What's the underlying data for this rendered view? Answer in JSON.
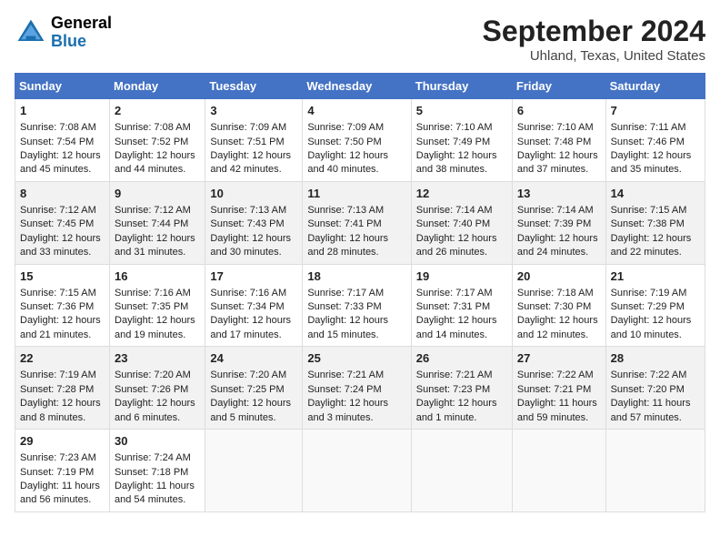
{
  "header": {
    "logo_line1": "General",
    "logo_line2": "Blue",
    "month_year": "September 2024",
    "location": "Uhland, Texas, United States"
  },
  "columns": [
    "Sunday",
    "Monday",
    "Tuesday",
    "Wednesday",
    "Thursday",
    "Friday",
    "Saturday"
  ],
  "weeks": [
    [
      {
        "day": 1,
        "sunrise": "7:08 AM",
        "sunset": "7:54 PM",
        "daylight": "12 hours and 45 minutes."
      },
      {
        "day": 2,
        "sunrise": "7:08 AM",
        "sunset": "7:52 PM",
        "daylight": "12 hours and 44 minutes."
      },
      {
        "day": 3,
        "sunrise": "7:09 AM",
        "sunset": "7:51 PM",
        "daylight": "12 hours and 42 minutes."
      },
      {
        "day": 4,
        "sunrise": "7:09 AM",
        "sunset": "7:50 PM",
        "daylight": "12 hours and 40 minutes."
      },
      {
        "day": 5,
        "sunrise": "7:10 AM",
        "sunset": "7:49 PM",
        "daylight": "12 hours and 38 minutes."
      },
      {
        "day": 6,
        "sunrise": "7:10 AM",
        "sunset": "7:48 PM",
        "daylight": "12 hours and 37 minutes."
      },
      {
        "day": 7,
        "sunrise": "7:11 AM",
        "sunset": "7:46 PM",
        "daylight": "12 hours and 35 minutes."
      }
    ],
    [
      {
        "day": 8,
        "sunrise": "7:12 AM",
        "sunset": "7:45 PM",
        "daylight": "12 hours and 33 minutes."
      },
      {
        "day": 9,
        "sunrise": "7:12 AM",
        "sunset": "7:44 PM",
        "daylight": "12 hours and 31 minutes."
      },
      {
        "day": 10,
        "sunrise": "7:13 AM",
        "sunset": "7:43 PM",
        "daylight": "12 hours and 30 minutes."
      },
      {
        "day": 11,
        "sunrise": "7:13 AM",
        "sunset": "7:41 PM",
        "daylight": "12 hours and 28 minutes."
      },
      {
        "day": 12,
        "sunrise": "7:14 AM",
        "sunset": "7:40 PM",
        "daylight": "12 hours and 26 minutes."
      },
      {
        "day": 13,
        "sunrise": "7:14 AM",
        "sunset": "7:39 PM",
        "daylight": "12 hours and 24 minutes."
      },
      {
        "day": 14,
        "sunrise": "7:15 AM",
        "sunset": "7:38 PM",
        "daylight": "12 hours and 22 minutes."
      }
    ],
    [
      {
        "day": 15,
        "sunrise": "7:15 AM",
        "sunset": "7:36 PM",
        "daylight": "12 hours and 21 minutes."
      },
      {
        "day": 16,
        "sunrise": "7:16 AM",
        "sunset": "7:35 PM",
        "daylight": "12 hours and 19 minutes."
      },
      {
        "day": 17,
        "sunrise": "7:16 AM",
        "sunset": "7:34 PM",
        "daylight": "12 hours and 17 minutes."
      },
      {
        "day": 18,
        "sunrise": "7:17 AM",
        "sunset": "7:33 PM",
        "daylight": "12 hours and 15 minutes."
      },
      {
        "day": 19,
        "sunrise": "7:17 AM",
        "sunset": "7:31 PM",
        "daylight": "12 hours and 14 minutes."
      },
      {
        "day": 20,
        "sunrise": "7:18 AM",
        "sunset": "7:30 PM",
        "daylight": "12 hours and 12 minutes."
      },
      {
        "day": 21,
        "sunrise": "7:19 AM",
        "sunset": "7:29 PM",
        "daylight": "12 hours and 10 minutes."
      }
    ],
    [
      {
        "day": 22,
        "sunrise": "7:19 AM",
        "sunset": "7:28 PM",
        "daylight": "12 hours and 8 minutes."
      },
      {
        "day": 23,
        "sunrise": "7:20 AM",
        "sunset": "7:26 PM",
        "daylight": "12 hours and 6 minutes."
      },
      {
        "day": 24,
        "sunrise": "7:20 AM",
        "sunset": "7:25 PM",
        "daylight": "12 hours and 5 minutes."
      },
      {
        "day": 25,
        "sunrise": "7:21 AM",
        "sunset": "7:24 PM",
        "daylight": "12 hours and 3 minutes."
      },
      {
        "day": 26,
        "sunrise": "7:21 AM",
        "sunset": "7:23 PM",
        "daylight": "12 hours and 1 minute."
      },
      {
        "day": 27,
        "sunrise": "7:22 AM",
        "sunset": "7:21 PM",
        "daylight": "11 hours and 59 minutes."
      },
      {
        "day": 28,
        "sunrise": "7:22 AM",
        "sunset": "7:20 PM",
        "daylight": "11 hours and 57 minutes."
      }
    ],
    [
      {
        "day": 29,
        "sunrise": "7:23 AM",
        "sunset": "7:19 PM",
        "daylight": "11 hours and 56 minutes."
      },
      {
        "day": 30,
        "sunrise": "7:24 AM",
        "sunset": "7:18 PM",
        "daylight": "11 hours and 54 minutes."
      },
      null,
      null,
      null,
      null,
      null
    ]
  ]
}
